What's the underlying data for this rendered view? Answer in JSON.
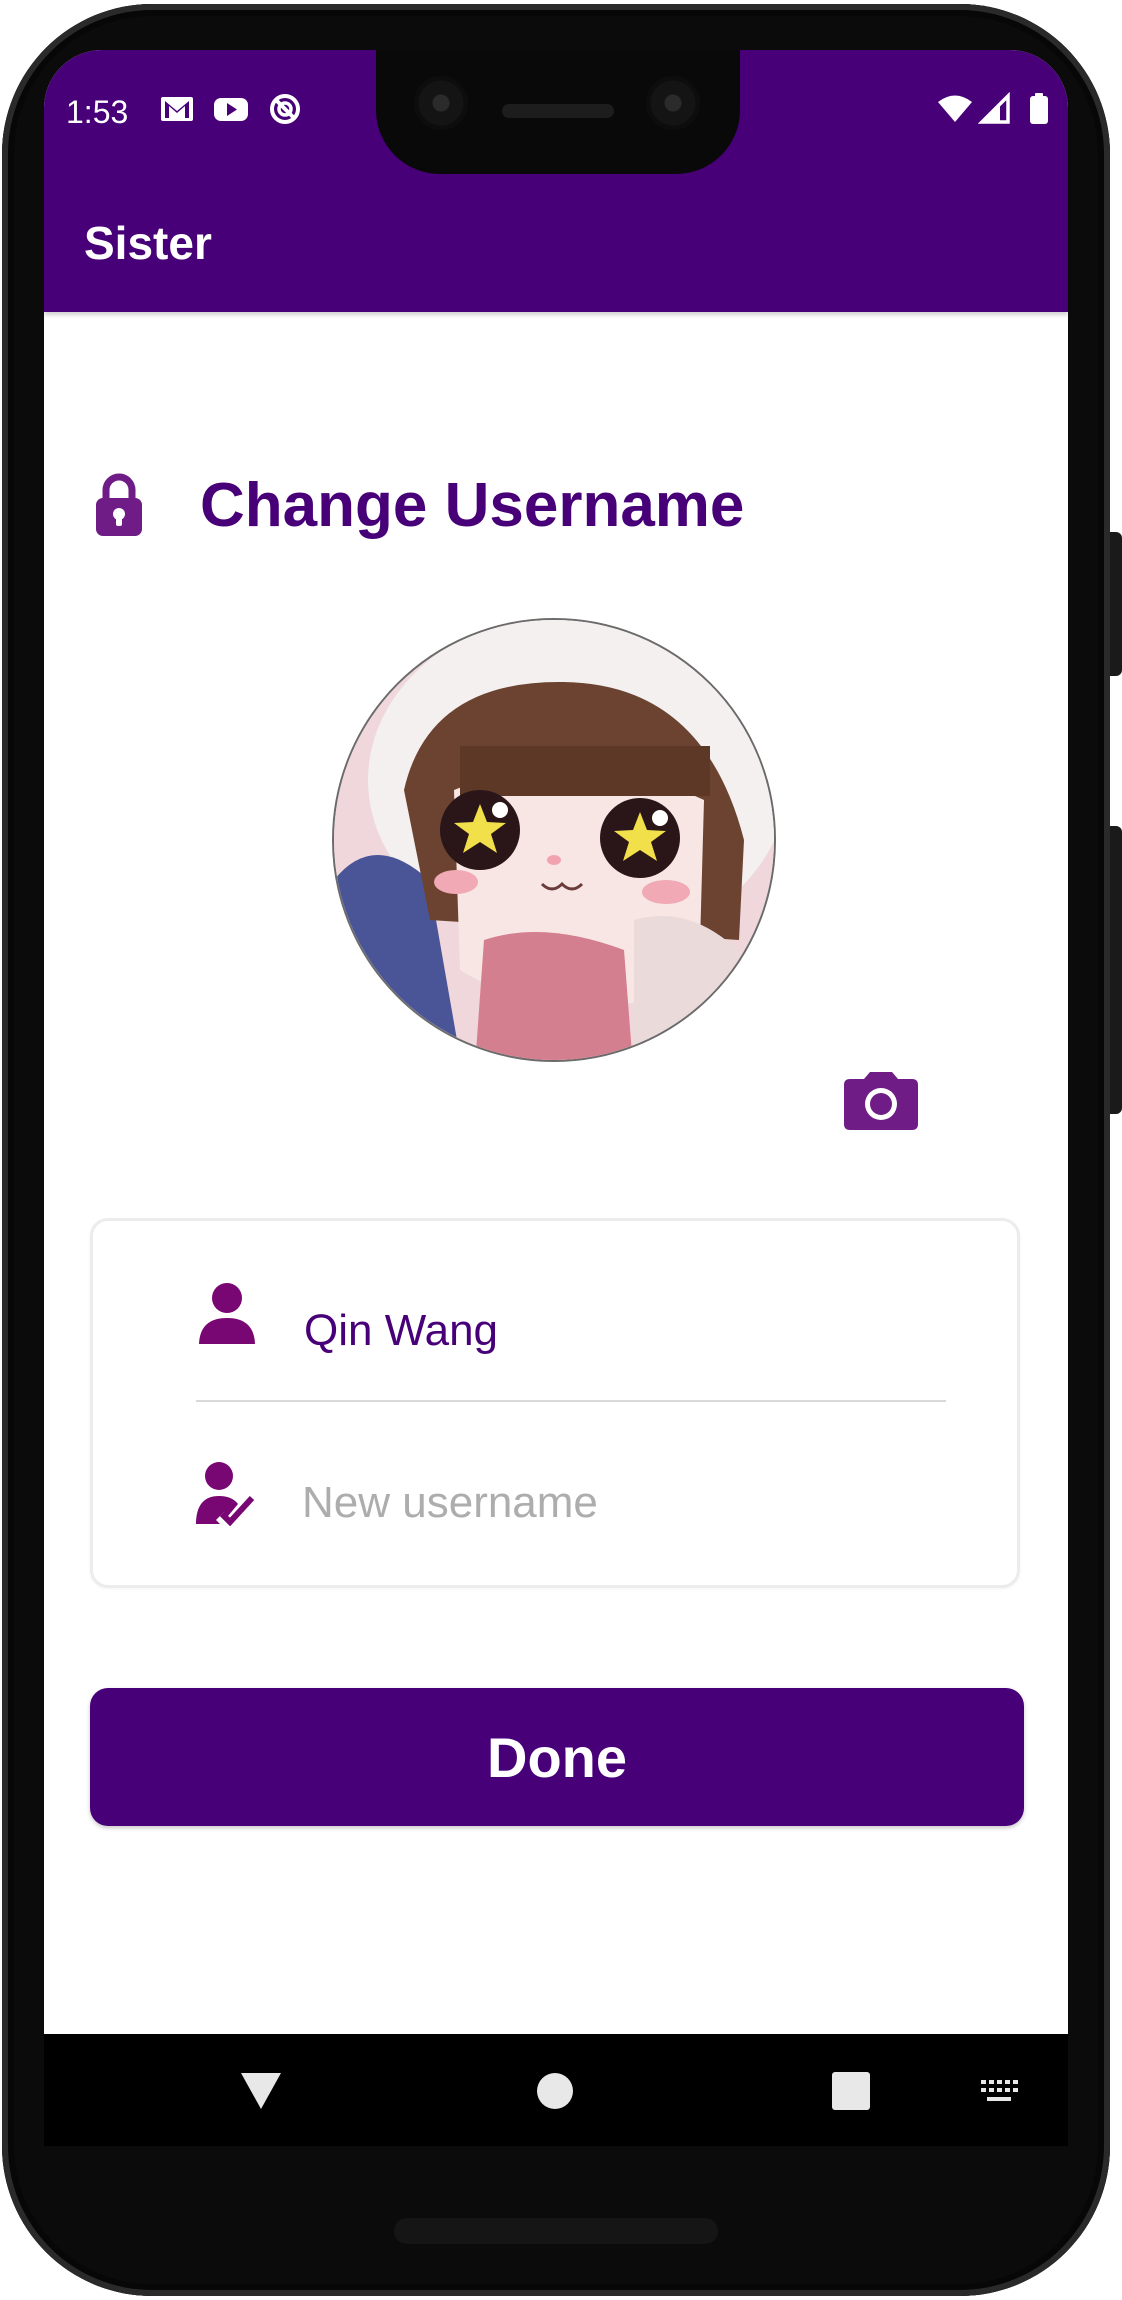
{
  "status_bar": {
    "time": "1:53",
    "left_icons": [
      "gmail-icon",
      "youtube-icon",
      "do-not-disturb-icon"
    ],
    "right_icons": [
      "wifi-icon",
      "cellular-signal-icon",
      "battery-icon"
    ]
  },
  "app_bar": {
    "title": "Sister",
    "background_color": "#470078"
  },
  "section": {
    "icon": "lock-icon",
    "title": "Change Username"
  },
  "profile": {
    "avatar": "profile-avatar-anime-girl",
    "edit_icon": "camera-icon"
  },
  "form": {
    "current_username": {
      "icon": "person-icon",
      "value": "Qin Wang"
    },
    "new_username": {
      "icon": "person-check-icon",
      "placeholder": "New username",
      "value": ""
    }
  },
  "actions": {
    "done_label": "Done"
  },
  "nav_bar": {
    "items": [
      "back-triangle-icon",
      "home-circle-icon",
      "recents-square-icon",
      "keyboard-icon"
    ]
  },
  "colors": {
    "primary": "#470078",
    "icon_accent": "#6f1c86",
    "placeholder": "#adadad"
  }
}
